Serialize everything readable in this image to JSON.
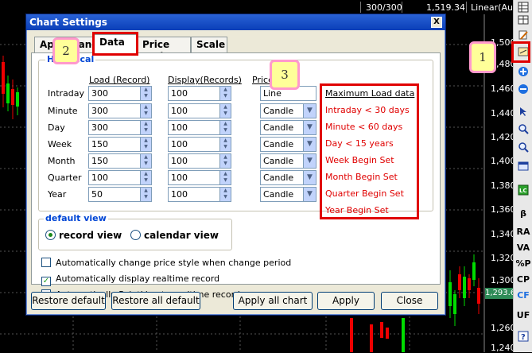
{
  "status_bar": {
    "counter": "300/300",
    "price": "1,519.34",
    "scale": "Linear(Aut"
  },
  "price_axis": [
    "1,480",
    "1,460",
    "1,440",
    "1,420",
    "1,400",
    "1,380",
    "1,360",
    "1,340",
    "1,320",
    "1,300",
    "1,260",
    "1,240"
  ],
  "price_partial_top": "1,500",
  "current_price_tag": "1,293.6",
  "right_toolbar": {
    "text_buttons": [
      "RA",
      "VA",
      "%P",
      "CP",
      "CF",
      "UF"
    ],
    "beta": "β",
    "help": "?"
  },
  "dialog": {
    "title": "Chart Settings",
    "close_label": "X",
    "tabs": [
      {
        "label": "Appearance"
      },
      {
        "label": "Data"
      },
      {
        "label": "Price Style"
      },
      {
        "label": "Scale"
      }
    ],
    "historical_group": "Historical",
    "col_load": "Load (Record)",
    "col_display": "Display(Records)",
    "col_price": "Price",
    "rows": [
      {
        "label": "Intraday",
        "load": "300",
        "display": "100",
        "price": "Line"
      },
      {
        "label": "Minute",
        "load": "300",
        "display": "100",
        "price": "Candle"
      },
      {
        "label": "Day",
        "load": "300",
        "display": "100",
        "price": "Candle"
      },
      {
        "label": "Week",
        "load": "150",
        "display": "100",
        "price": "Candle"
      },
      {
        "label": "Month",
        "load": "150",
        "display": "100",
        "price": "Candle"
      },
      {
        "label": "Quarter",
        "load": "100",
        "display": "100",
        "price": "Candle"
      },
      {
        "label": "Year",
        "load": "50",
        "display": "100",
        "price": "Candle"
      }
    ],
    "max_load_title": "Maximum Load data",
    "max_load_items": [
      "Intraday < 30 days",
      "Minute < 60 days",
      "Day < 15 years",
      "Week Begin Set",
      "Month Begin Set",
      "Quarter Begin Set",
      "Year Begin Set"
    ],
    "default_view_group": "default view",
    "record_view": "record view",
    "calendar_view": "calendar view",
    "checkboxes": [
      {
        "label": "Automatically change price style when change period",
        "checked": false
      },
      {
        "label": "Automatically display realtime record",
        "checked": true
      },
      {
        "label": "Automatically PointLine to realtime record",
        "checked": false
      }
    ],
    "buttons": {
      "restore_default": "Restore default",
      "restore_all_default": "Restore all default",
      "apply_all_chart": "Apply all chart",
      "apply": "Apply",
      "close": "Close"
    }
  },
  "callouts": [
    "1",
    "2",
    "3"
  ],
  "colors": {
    "accent_red": "#e00000",
    "callout_fill": "#ffff99",
    "callout_border": "#ff99cc",
    "up_candle": "#00dd00",
    "down_candle": "#ee0000"
  }
}
